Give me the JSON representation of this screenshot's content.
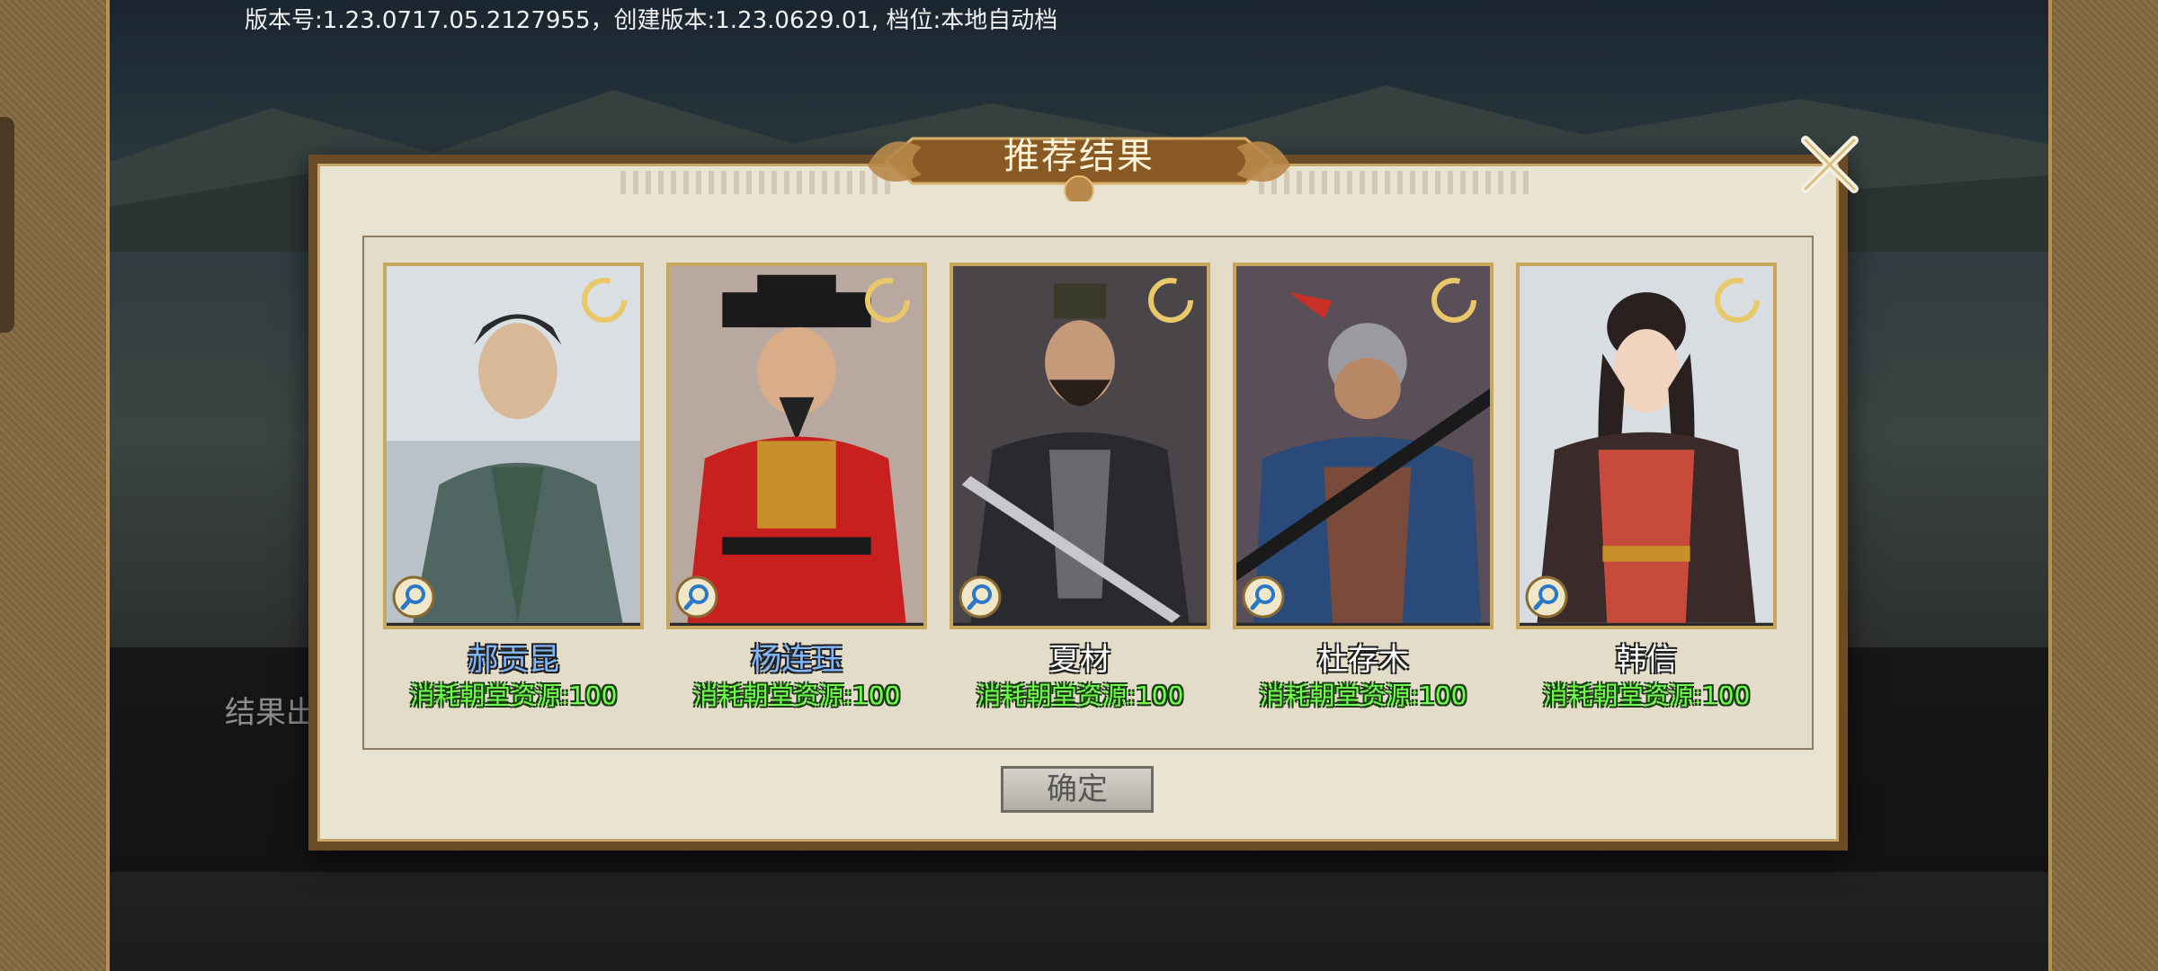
{
  "version_text": "版本号:1.23.0717.05.2127955，创建版本:1.23.0629.01, 档位:本地自动档",
  "background_text": "结果出",
  "dialog": {
    "title": "推荐结果",
    "confirm_label": "确定",
    "close_icon": "close-x-icon"
  },
  "cards": [
    {
      "name": "郝贡昆",
      "name_color": "#7fb8ff",
      "cost": "消耗朝堂资源:100"
    },
    {
      "name": "杨连珏",
      "name_color": "#7fb8ff",
      "cost": "消耗朝堂资源:100"
    },
    {
      "name": "夏材",
      "name_color": "#ffffff",
      "cost": "消耗朝堂资源:100"
    },
    {
      "name": "杜存木",
      "name_color": "#ffffff",
      "cost": "消耗朝堂资源:100"
    },
    {
      "name": "韩信",
      "name_color": "#ffffff",
      "cost": "消耗朝堂资源:100"
    }
  ],
  "colors": {
    "cost_green": "#6bff4a",
    "frame_gold": "#c8a75c",
    "dialog_border": "#6b4a26"
  }
}
